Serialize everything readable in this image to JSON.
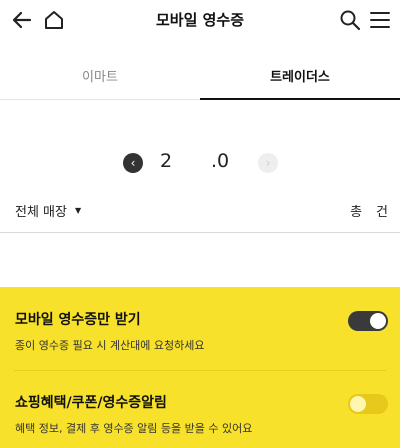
{
  "header": {
    "title": "모바일 영수증",
    "icons": [
      "back-arrow-icon",
      "home-icon",
      "search-icon",
      "menu-icon"
    ]
  },
  "tabs": [
    {
      "label": "이마트",
      "selected": false
    },
    {
      "label": "트레이더스",
      "selected": true
    }
  ],
  "period": {
    "year": "2",
    "month": ".0",
    "prev_icon": "‹",
    "next_icon": "›"
  },
  "filter": {
    "store_label": "전체 매장",
    "total_label": "총",
    "count_unit": "건"
  },
  "options": [
    {
      "title": "모바일 영수증만 받기",
      "description": "종이 영수증 필요 시 계산대에 요청하세요",
      "toggle": "on"
    },
    {
      "title": "쇼핑혜택/쿠폰/영수증알림",
      "description": "혜택 정보, 결제 후 영수증 알림 등을 받을 수 있어요",
      "toggle": "off"
    }
  ],
  "colors": {
    "accent_yellow": "#f7e12a",
    "toggle_on": "#3a3a3a"
  }
}
